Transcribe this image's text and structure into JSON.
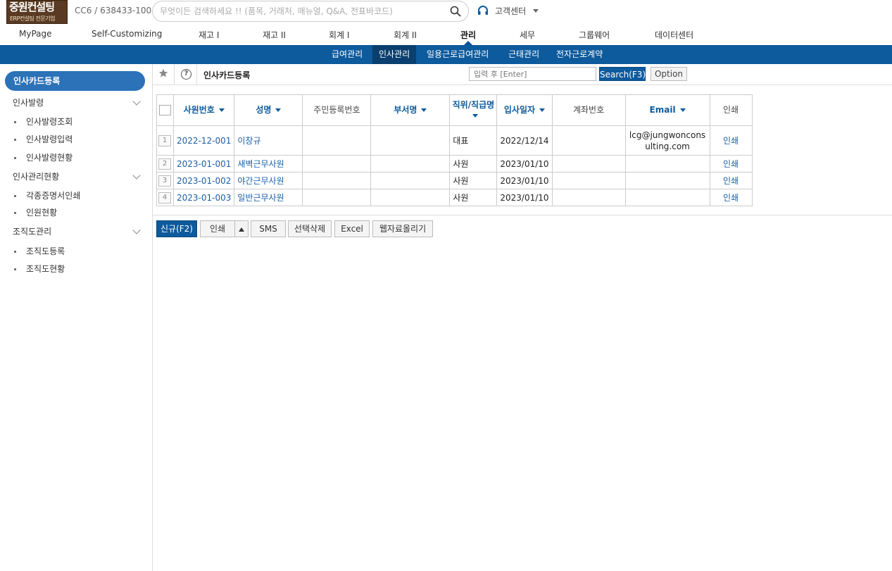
{
  "logo": {
    "title": "중원컨설팅",
    "subtitle": "ERP컨설팅 전문기업"
  },
  "company_code": "CC6 / 638433-100",
  "search": {
    "placeholder": "무엇이든 검색하세요 !! (품목, 거래처, 매뉴얼, Q&A, 전표바코드)"
  },
  "customer_center": "고객센터",
  "main_menu": [
    "MyPage",
    "Self-Customizing",
    "재고 I",
    "재고 II",
    "회계 I",
    "회계 II",
    "관리",
    "세무",
    "그룹웨어",
    "데이터센터"
  ],
  "main_menu_active": "관리",
  "sub_menu": [
    "급여관리",
    "인사관리",
    "일용근로급여관리",
    "근태관리",
    "전자근로계약"
  ],
  "sub_menu_active": "인사관리",
  "sidebar": {
    "title": "인사카드등록",
    "groups": [
      {
        "label": "인사발령",
        "items": [
          "인사발령조회",
          "인사발령입력",
          "인사발령현황"
        ]
      },
      {
        "label": "인사관리현황",
        "items": [
          "각종증명서인쇄",
          "인원현황"
        ]
      },
      {
        "label": "조직도관리",
        "items": [
          "조직도등록",
          "조직도현황"
        ]
      }
    ]
  },
  "content": {
    "page_title": "인사카드등록",
    "filter_placeholder": "입력 후 [Enter]",
    "search_btn": "Search(F3)",
    "option_btn": "Option"
  },
  "table": {
    "headers": {
      "emp_no": "사원번호",
      "name": "성명",
      "rrn": "주민등록번호",
      "dept": "부서명",
      "position": "직위/직급명",
      "hire_date": "입사일자",
      "account": "계좌번호",
      "email": "Email",
      "print": "인쇄"
    },
    "rows": [
      {
        "num": "1",
        "emp_no": "2022-12-001",
        "name": "이창규",
        "rrn": "",
        "dept": "",
        "position": "대표",
        "hire_date": "2022/12/14",
        "account": "",
        "email": "lcg@jungwonconsulting.com",
        "print": "인쇄"
      },
      {
        "num": "2",
        "emp_no": "2023-01-001",
        "name": "새벽근무사원",
        "rrn": "",
        "dept": "",
        "position": "사원",
        "hire_date": "2023/01/10",
        "account": "",
        "email": "",
        "print": "인쇄"
      },
      {
        "num": "3",
        "emp_no": "2023-01-002",
        "name": "야간근무사원",
        "rrn": "",
        "dept": "",
        "position": "사원",
        "hire_date": "2023/01/10",
        "account": "",
        "email": "",
        "print": "인쇄"
      },
      {
        "num": "4",
        "emp_no": "2023-01-003",
        "name": "일반근무사원",
        "rrn": "",
        "dept": "",
        "position": "사원",
        "hire_date": "2023/01/10",
        "account": "",
        "email": "",
        "print": "인쇄"
      }
    ]
  },
  "buttons": {
    "new": "신규(F2)",
    "print": "인쇄",
    "sms": "SMS",
    "delete_selected": "선택삭제",
    "excel": "Excel",
    "web_upload": "웹자료올리기"
  },
  "colors": {
    "primary": "#0d5a9c",
    "sidebar_title": "#2b72b8",
    "link": "#1a5fa8"
  }
}
